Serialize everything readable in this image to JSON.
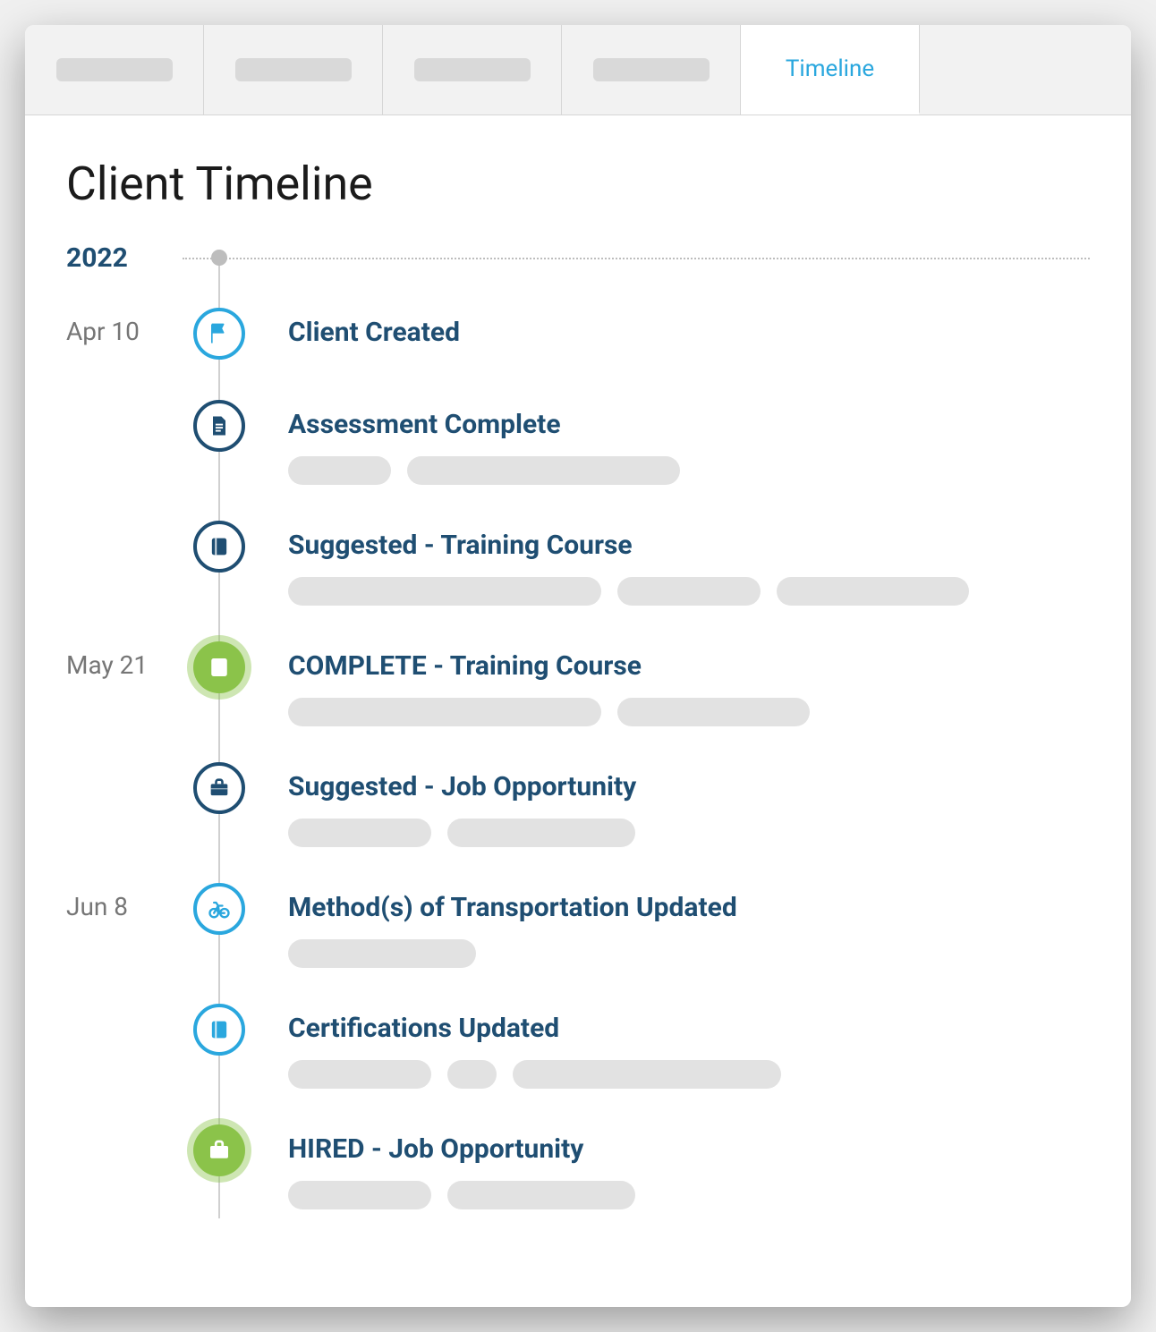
{
  "tabs": {
    "placeholders": [
      "",
      "",
      "",
      ""
    ],
    "active_label": "Timeline"
  },
  "page": {
    "title": "Client Timeline",
    "year": "2022"
  },
  "colors": {
    "navy": "#1f4e72",
    "cyan": "#2aa7de",
    "green": "#8bc34a"
  },
  "entries": [
    {
      "date": "Apr 10",
      "icon": "flag",
      "style": "cyan-outline",
      "title": "Client Created",
      "pills": []
    },
    {
      "date": "",
      "icon": "document",
      "style": "navy-outline",
      "title": "Assessment Complete",
      "pills": [
        115,
        305
      ]
    },
    {
      "date": "",
      "icon": "book",
      "style": "navy-outline",
      "title": "Suggested - Training Course",
      "pills": [
        350,
        160,
        215
      ]
    },
    {
      "date": "May 21",
      "icon": "book",
      "style": "green-fill",
      "title": "COMPLETE - Training Course",
      "pills": [
        350,
        215
      ]
    },
    {
      "date": "",
      "icon": "briefcase",
      "style": "navy-outline",
      "title": "Suggested - Job Opportunity",
      "pills": [
        160,
        210
      ]
    },
    {
      "date": "Jun 8",
      "icon": "bicycle",
      "style": "cyan-outline",
      "title": "Method(s) of Transportation Updated",
      "pills": [
        210
      ]
    },
    {
      "date": "",
      "icon": "book",
      "style": "cyan-outline",
      "title": "Certifications Updated",
      "pills": [
        160,
        55,
        300
      ]
    },
    {
      "date": "",
      "icon": "briefcase",
      "style": "green-fill",
      "title": "HIRED - Job Opportunity",
      "pills": [
        160,
        210
      ]
    }
  ]
}
